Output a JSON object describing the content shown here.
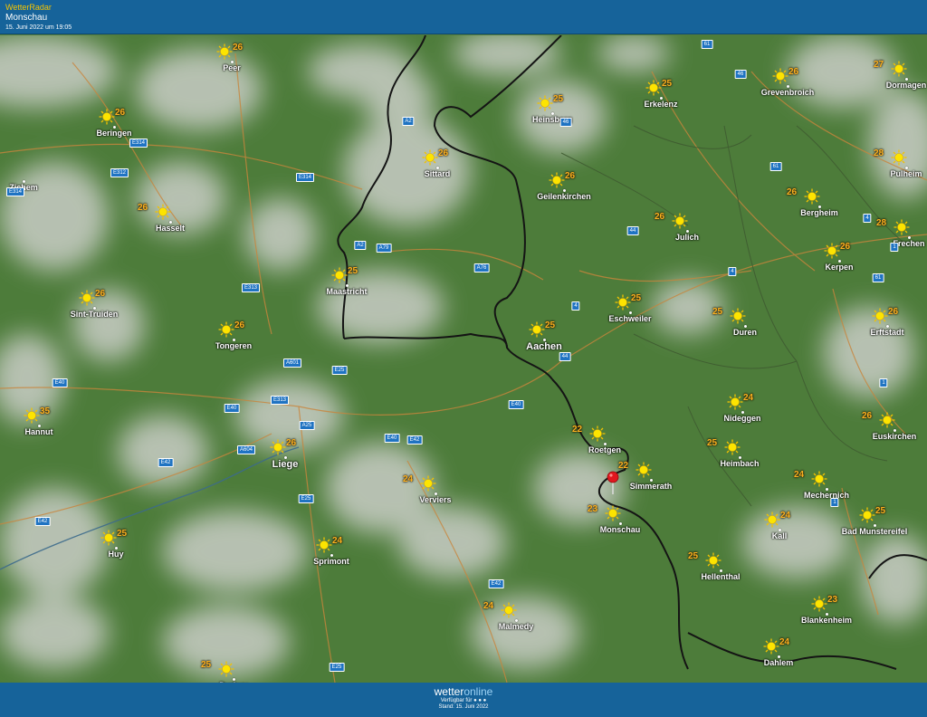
{
  "header": {
    "app_name": "WetterRadar",
    "location": "Monschau",
    "timestamp": "15. Juni 2022 um 19:05"
  },
  "footer": {
    "brand_a": "wetter",
    "brand_b": "online",
    "available": "Verfügbar für ● ● ●",
    "stand": "Stand: 15. Juni 2022"
  },
  "colors": {
    "header_bg": "#16639a",
    "temp": "#fbb01f",
    "land": "#4f7a3c",
    "road_badge": "#1f73c2"
  },
  "cities": [
    {
      "name": "Peer",
      "temp": "26"
    },
    {
      "name": "Beringen",
      "temp": "26"
    },
    {
      "name": "Zichem",
      "temp": ""
    },
    {
      "name": "Hasselt",
      "temp": "26"
    },
    {
      "name": "Sint-Truiden",
      "temp": "26"
    },
    {
      "name": "Tongeren",
      "temp": "26"
    },
    {
      "name": "Hannut",
      "temp": "35"
    },
    {
      "name": "Liege",
      "temp": "26"
    },
    {
      "name": "Huy",
      "temp": "25"
    },
    {
      "name": "Sprimont",
      "temp": "24"
    },
    {
      "name": "Durbuy",
      "temp": "25"
    },
    {
      "name": "Maastricht",
      "temp": "25"
    },
    {
      "name": "Sittard",
      "temp": "26"
    },
    {
      "name": "Heinsberg",
      "temp": "25"
    },
    {
      "name": "Erkelenz",
      "temp": "25"
    },
    {
      "name": "Grevenbroich",
      "temp": "26"
    },
    {
      "name": "Dormagen",
      "temp": "27"
    },
    {
      "name": "Geilenkirchen",
      "temp": "26"
    },
    {
      "name": "Pulheim",
      "temp": "28"
    },
    {
      "name": "Bergheim",
      "temp": "26"
    },
    {
      "name": "Julich",
      "temp": "26"
    },
    {
      "name": "Frechen",
      "temp": "28"
    },
    {
      "name": "Kerpen",
      "temp": "26"
    },
    {
      "name": "Aachen",
      "temp": "25"
    },
    {
      "name": "Eschweiler",
      "temp": "25"
    },
    {
      "name": "Duren",
      "temp": "25"
    },
    {
      "name": "Erftstadt",
      "temp": "26"
    },
    {
      "name": "Nideggen",
      "temp": "24"
    },
    {
      "name": "Euskirchen",
      "temp": "26"
    },
    {
      "name": "Roetgen",
      "temp": "22"
    },
    {
      "name": "Heimbach",
      "temp": "25"
    },
    {
      "name": "Simmerath",
      "temp": "22"
    },
    {
      "name": "Mechernich",
      "temp": "24"
    },
    {
      "name": "Verviers",
      "temp": "24"
    },
    {
      "name": "Monschau",
      "temp": "23"
    },
    {
      "name": "Kall",
      "temp": "24"
    },
    {
      "name": "Bad Munstereifel",
      "temp": "25"
    },
    {
      "name": "Hellenthal",
      "temp": "25"
    },
    {
      "name": "Blankenheim",
      "temp": "23"
    },
    {
      "name": "Malmedy",
      "temp": "24"
    },
    {
      "name": "Dahlem",
      "temp": "24"
    }
  ],
  "roads": [
    "61",
    "46",
    "A2",
    "46",
    "E314",
    "E312",
    "E314",
    "E314",
    "61",
    "A2",
    "A79",
    "44",
    "4",
    "A76",
    "E313",
    "4",
    "61",
    "1",
    "4",
    "A601",
    "E25",
    "44",
    "E313",
    "E40",
    "E40",
    "A25",
    "E40",
    "E42",
    "E40",
    "E42",
    "A604",
    "E25",
    "1",
    "1",
    "E42",
    "E42",
    "E25"
  ]
}
